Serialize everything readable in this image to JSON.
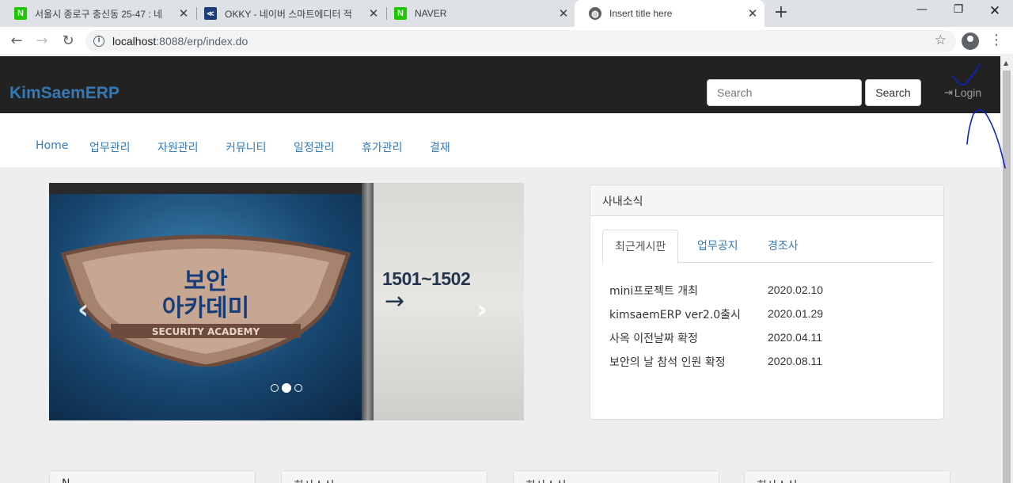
{
  "browser": {
    "tabs": [
      {
        "title": "서울시 종로구 충신동 25-47 : 네",
        "favicon": "naver-n-icon",
        "active": false
      },
      {
        "title": "OKKY - 네이버 스마트에디터 적",
        "favicon": "okky-icon",
        "active": false
      },
      {
        "title": "NAVER",
        "favicon": "naver-n-icon",
        "active": false
      },
      {
        "title": "Insert title here",
        "favicon": "globe-icon",
        "active": true
      }
    ],
    "url_host": "localhost",
    "url_rest": ":8088/erp/index.do"
  },
  "site": {
    "brand": "KimSaemERP",
    "search_placeholder": "Search",
    "search_button": "Search",
    "login_label": "Login",
    "menu": [
      "Home",
      "업무관리",
      "자원관리",
      "커뮤니티",
      "일정관리",
      "휴가관리",
      "결재"
    ]
  },
  "carousel": {
    "sign_number": "1501~1502",
    "sign_arrow": "→",
    "shield_text_1": "보안",
    "shield_text_2": "아카데미",
    "shield_band": "SECURITY ACADEMY",
    "prev_icon": "‹",
    "next_icon": "›",
    "slide_count": 3,
    "active_slide": 2
  },
  "news": {
    "panel_title": "사내소식",
    "tabs": [
      "최근게시판",
      "업무공지",
      "경조사"
    ],
    "items": [
      {
        "title": "mini프로젝트 개최",
        "date": "2020.02.10"
      },
      {
        "title": "kimsaemERP ver2.0출시",
        "date": "2020.01.29"
      },
      {
        "title": "사옥 이전날짜 확정",
        "date": "2020.04.11"
      },
      {
        "title": "보안의 날 참석 인원 확정",
        "date": "2020.08.11"
      }
    ]
  },
  "cards": [
    {
      "title": "N"
    },
    {
      "title": "회사소식"
    },
    {
      "title": "회사소식"
    },
    {
      "title": "회사소식"
    }
  ],
  "colors": {
    "navbar": "#222222",
    "link": "#337ab7",
    "page_bg": "#eeeeee",
    "annotation": "#0a23c8"
  }
}
